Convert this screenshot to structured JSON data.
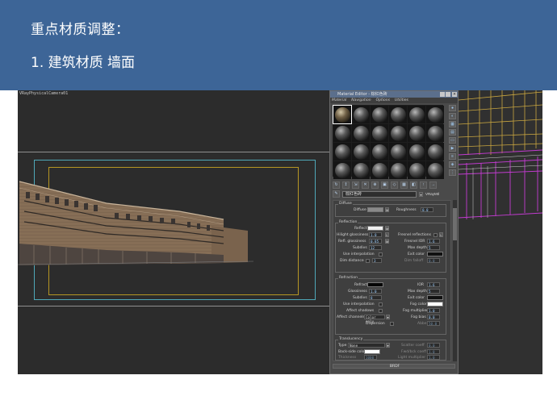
{
  "slide": {
    "title": "重点材质调整：",
    "subtitle": "1.  建筑材质  墙面"
  },
  "viewport": {
    "label": "VRayPhysicalCamera01"
  },
  "material_editor": {
    "title": "Material Editor - 棕红色砖",
    "menu": [
      "Material",
      "Navigation",
      "Options",
      "Utilities"
    ],
    "material_name": "棕红色砖",
    "material_type": "VRayMtl",
    "diffuse": {
      "group": "Diffuse",
      "diffuse_label": "Diffuse",
      "diffuse_map": "M",
      "roughness_label": "Roughness",
      "roughness_value": "0.0"
    },
    "reflection": {
      "group": "Reflection",
      "reflect_label": "Reflect",
      "reflect_map": "M",
      "hilight_label": "Hilight glossiness",
      "hilight_value": "1.0",
      "hilight_lock": "L",
      "fresnel_label": "Fresnel reflections",
      "fresnel_lock": "L",
      "refl_gloss_label": "Refl. glossiness",
      "refl_gloss_value": "0.85",
      "refl_gloss_map": "M",
      "fresnel_ior_label": "Fresnel IOR",
      "fresnel_ior_value": "1.6",
      "subdivs_label": "Subdivs",
      "subdivs_value": "12",
      "max_depth_label": "Max depth",
      "max_depth_value": "5",
      "use_interp_label": "Use interpolation",
      "exit_color_label": "Exit color",
      "dim_distance_label": "Dim distance",
      "dim_distance_value": "3",
      "dim_falloff_label": "Dim falloff",
      "dim_falloff_value": "0.0"
    },
    "refraction": {
      "group": "Refraction",
      "refract_label": "Refract",
      "ior_label": "IOR",
      "ior_value": "1.6",
      "glossiness_label": "Glossiness",
      "glossiness_value": "1.0",
      "max_depth_label": "Max depth",
      "max_depth_value": "5",
      "subdivs_label": "Subdivs",
      "subdivs_value": "8",
      "exit_color_label": "Exit color",
      "use_interp_label": "Use interpolation",
      "fog_color_label": "Fog color",
      "affect_shadows_label": "Affect shadows",
      "fog_mult_label": "Fog multiplier",
      "fog_mult_value": "1.0",
      "affect_channels_label": "Affect channels",
      "affect_channels_value": "Color only",
      "fog_bias_label": "Fog bias",
      "fog_bias_value": "0.0",
      "dispersion_label": "Dispersion",
      "abbe_label": "Abbe",
      "abbe_value": "50.0"
    },
    "translucency": {
      "group": "Translucency",
      "type_label": "Type",
      "type_value": "None",
      "back_side_label": "Back-side color",
      "thickness_label": "Thickness",
      "thickness_value": "1000",
      "scatter_coeff_label": "Scatter coeff",
      "scatter_coeff_value": "0.0",
      "light_mult_label": "Light multiplier",
      "light_mult_value": "1.0",
      "fwd_bck_label": "Fwd/bck coeff",
      "fwd_bck_value": "1.0"
    },
    "footer": "BRDF"
  },
  "colors": {
    "header_bg": "#3d6597",
    "viewport_bg": "#2c2c2c",
    "building_wall": "#8c7258",
    "wire_yellow": "#c9a640",
    "wire_magenta": "#c23bd0"
  }
}
